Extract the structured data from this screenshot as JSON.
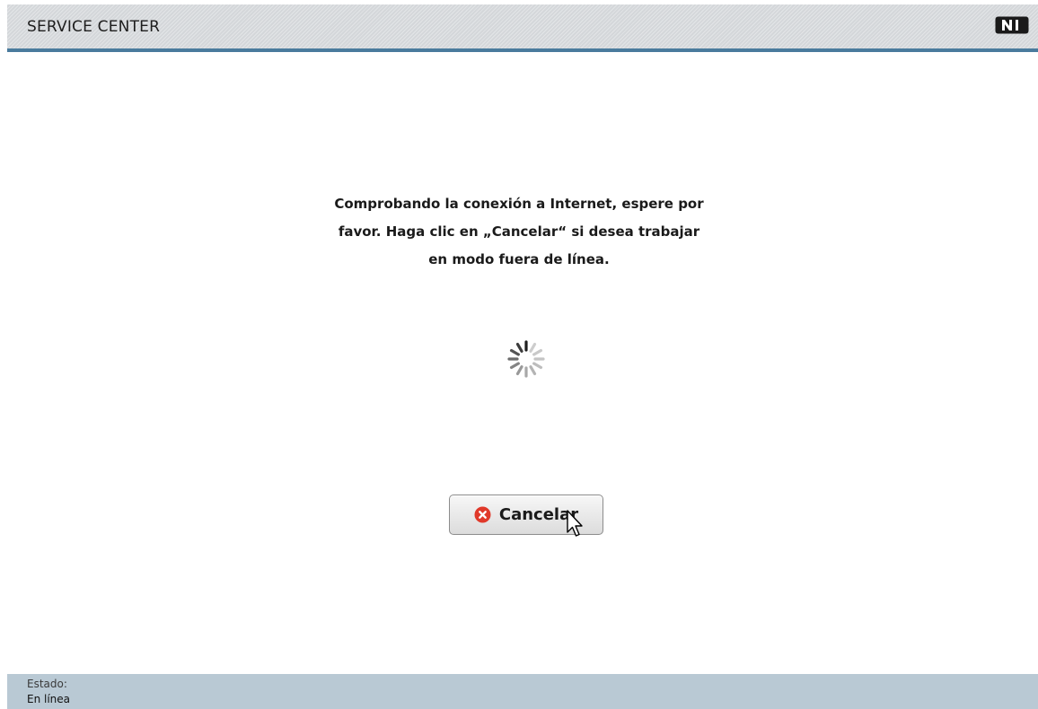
{
  "header": {
    "title": "SERVICE CENTER",
    "logo": "ni-logo",
    "logo_text": "NI",
    "accent_color": "#4a7b9d"
  },
  "main": {
    "message_lines": [
      "Comprobando la conexión a Internet, espere por",
      "favor. Haga clic en „Cancelar“ si desea trabajar",
      "en modo fuera de línea."
    ],
    "spinner": "loading-spinner-icon",
    "cancel_button": {
      "label": "Cancelar",
      "icon": "close-circle-icon",
      "icon_color": "#e0392a"
    }
  },
  "status_bar": {
    "label": "Estado:",
    "value": "En línea"
  }
}
